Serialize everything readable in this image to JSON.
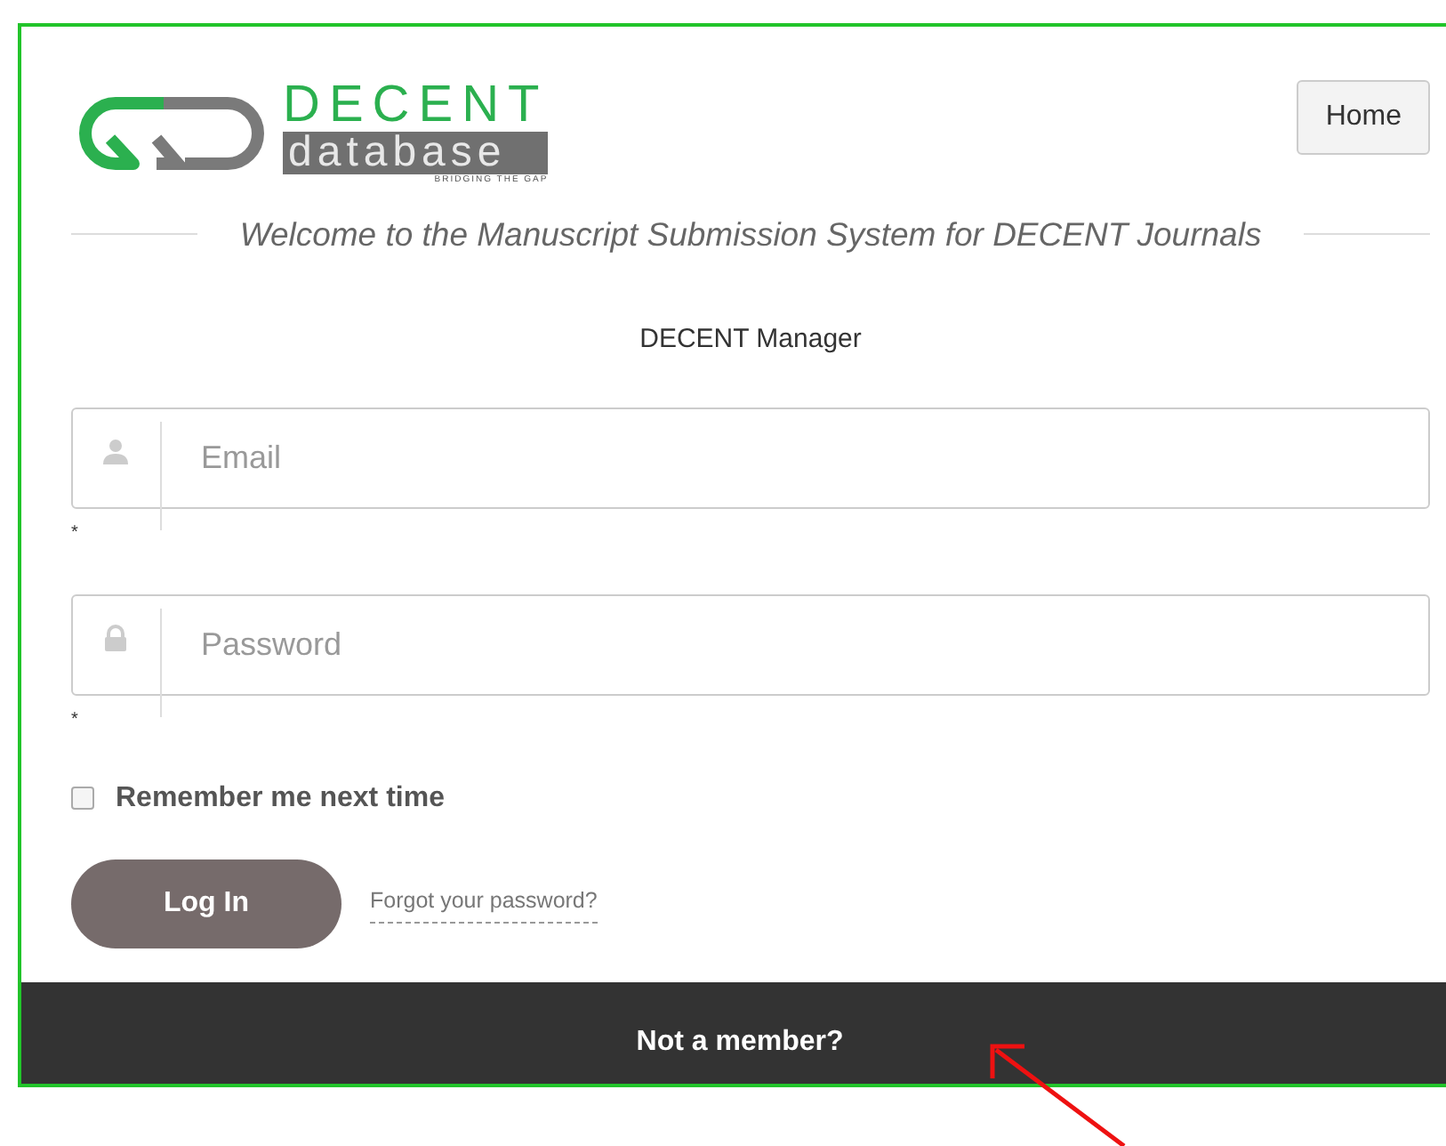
{
  "logo": {
    "title": "DECENT",
    "subtitle": "database",
    "tagline": "BRIDGING THE GAP"
  },
  "nav": {
    "home": "Home"
  },
  "welcome": "Welcome to the Manuscript Submission System for DECENT Journals",
  "manager": "DECENT Manager",
  "fields": [
    {
      "kind": "email",
      "placeholder": "Email",
      "required_mark": "*"
    },
    {
      "kind": "password",
      "placeholder": "Password",
      "required_mark": "*"
    }
  ],
  "remember": {
    "label": "Remember me next time",
    "checked": false
  },
  "login_button": "Log In",
  "forgot_link": "Forgot your password?",
  "footer": {
    "text": "Not a member?"
  },
  "annotation": {
    "kind": "arrow"
  }
}
